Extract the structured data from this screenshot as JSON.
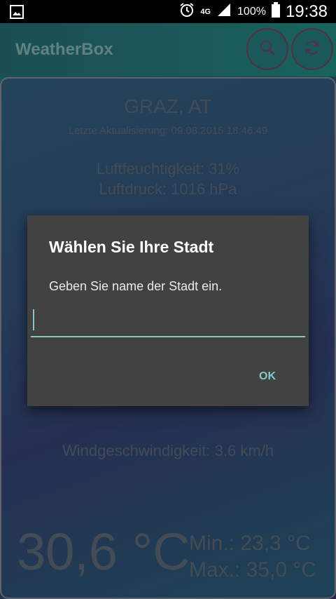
{
  "status_bar": {
    "network": "4G",
    "battery": "100%",
    "time": "19:38",
    "icons": [
      "image-icon",
      "alarm-icon",
      "signal-icon",
      "battery-icon"
    ]
  },
  "app": {
    "title": "WeatherBox",
    "search_icon": "search-icon",
    "refresh_icon": "refresh-icon"
  },
  "weather": {
    "city": "GRAZ, AT",
    "updated": "Letzte Aktualisierung: 09.08.2015 18:46:49",
    "humidity": "Luftfeuchtigkeit: 31%",
    "pressure": "Luftdruck: 1016 hPa",
    "wind": "Windgeschwindigkeit: 3.6 km/h",
    "temperature": "30,6 °C",
    "min": "Min.: 23,3 °C",
    "max": "Max.: 35,0 °C"
  },
  "dialog": {
    "title": "Wählen Sie Ihre Stadt",
    "message": "Geben Sie name der Stadt ein.",
    "input_value": "",
    "ok_label": "OK"
  },
  "colors": {
    "accent": "#80cbc4",
    "dialog_bg": "#424242",
    "appbar": "#2a8f92"
  }
}
